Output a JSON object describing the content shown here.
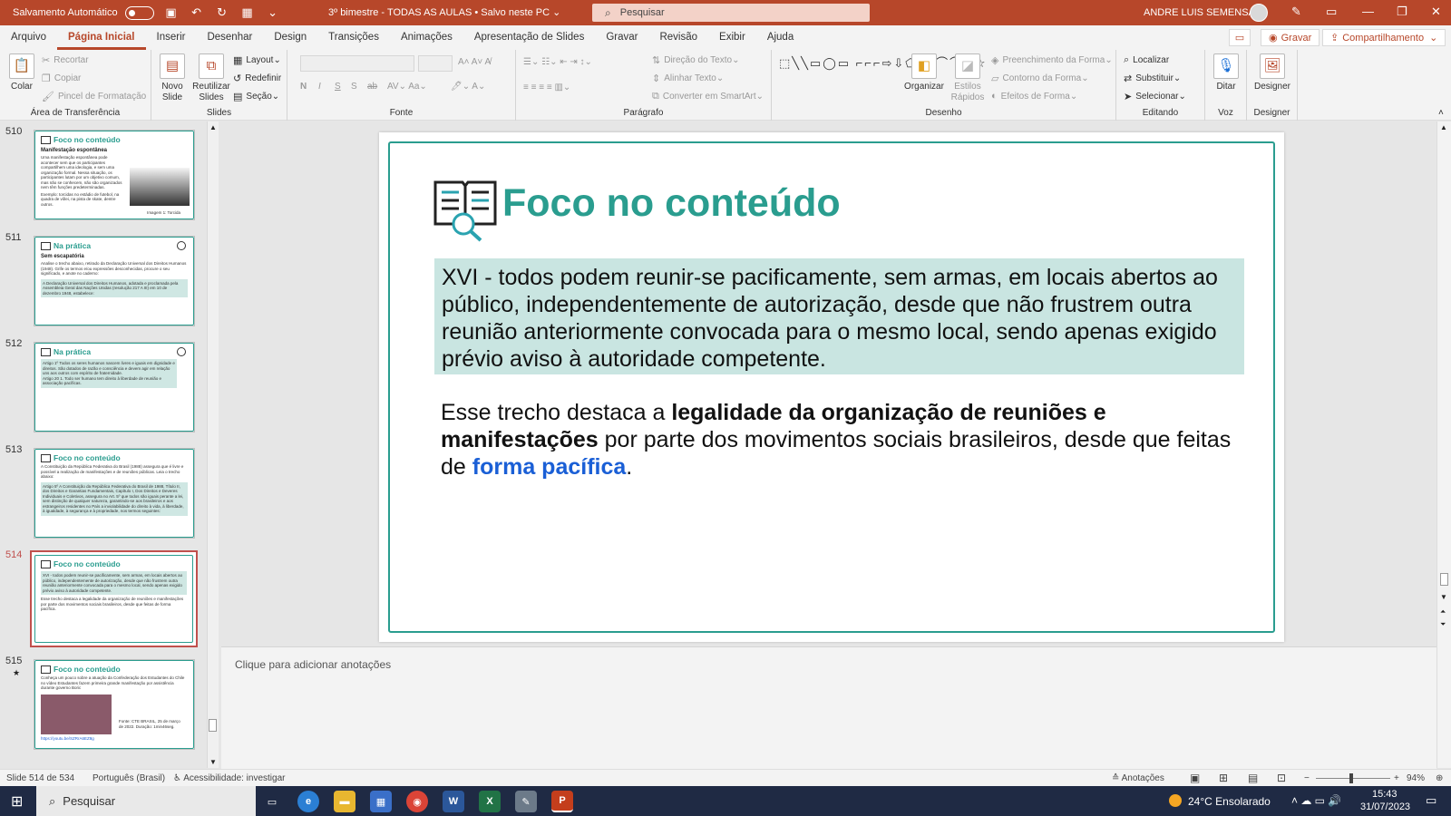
{
  "titlebar": {
    "autosave_label": "Salvamento Automático",
    "doc_title": "3º bimestre - TODAS AS AULAS • Salvo neste PC",
    "search_placeholder": "Pesquisar",
    "user": "ANDRE LUIS SEMENSATO"
  },
  "menu": {
    "tabs": [
      "Arquivo",
      "Página Inicial",
      "Inserir",
      "Desenhar",
      "Design",
      "Transições",
      "Animações",
      "Apresentação de Slides",
      "Gravar",
      "Revisão",
      "Exibir",
      "Ajuda"
    ],
    "record_label": "Gravar",
    "share_label": "Compartilhamento"
  },
  "ribbon": {
    "clipboard": {
      "paste": "Colar",
      "cut": "Recortar",
      "copy": "Copiar",
      "painter": "Pincel de Formatação",
      "label": "Área de Transferência"
    },
    "slides": {
      "new_slide_1": "Novo",
      "new_slide_2": "Slide",
      "reuse_1": "Reutilizar",
      "reuse_2": "Slides",
      "layout": "Layout",
      "reset": "Redefinir",
      "section": "Seção",
      "label": "Slides"
    },
    "font": {
      "bold": "N",
      "italic": "I",
      "underline": "S",
      "shadow": "S",
      "strike": "ab",
      "label": "Fonte"
    },
    "paragraph": {
      "text_dir": "Direção do Texto",
      "align_text": "Alinhar Texto",
      "smartart": "Converter em SmartArt",
      "label": "Parágrafo"
    },
    "drawing": {
      "arrange": "Organizar",
      "styles_1": "Estilos",
      "styles_2": "Rápidos",
      "fill": "Preenchimento da Forma",
      "outline": "Contorno da Forma",
      "effects": "Efeitos de Forma",
      "label": "Desenho"
    },
    "editing": {
      "find": "Localizar",
      "replace": "Substituir",
      "select": "Selecionar",
      "label": "Editando"
    },
    "voice": {
      "dictate": "Ditar",
      "label": "Voz"
    },
    "designer": {
      "designer": "Designer",
      "label": "Designer"
    }
  },
  "thumbnails": [
    {
      "num": "510",
      "title": "Foco no conteúdo",
      "subtitle": "Manifestação espontânea",
      "text": "Uma manifestação espontânea pode acontecer sem que os participantes compartilhem uma ideologia, e sem uma organização formal. Nessa situação, os participantes lutam por um objetivo comum, mas não se conhecem, não são organizados nem têm funções predeterminadas.",
      "text2": "Exemplo: torcidas no estádio de futebol, na quadra de vôlei, na pista de skate, dentre outros.",
      "caption": "Imagem 1: Torcida"
    },
    {
      "num": "511",
      "title": "Na prática",
      "subtitle": "Sem escapatória",
      "text": "Analise o trecho abaixo, retirado da Declaração Universal dos Direitos Humanos (1948). Grife os termos e/ou expressões desconhecidas, procure o seu significado, e anote no caderno:",
      "box": "A Declaração Universal dos Direitos Humanos, adotada e proclamada pela Assembleia Geral das Nações Unidas (resolução 217 A III) em 10 de dezembro 1948, estabelece:"
    },
    {
      "num": "512",
      "title": "Na prática",
      "box": "Artigo 1º Todos os seres humanos nascem livres e iguais em dignidade e direitos. São dotados de razão e consciência e devem agir em relação uns aos outros com espírito de fraternidade.",
      "box2": "Artigo 20 1. Todo ser humano tem direito à liberdade de reunião e associação pacíficas."
    },
    {
      "num": "513",
      "title": "Foco no conteúdo",
      "text": "A Constituição da República Federativa do Brasil (1988) assegura que é livre e possível a realização de manifestações e de reuniões públicas. Leia o trecho abaixo:",
      "box": "Artigo 5º A Constituição da República Federativa do Brasil de 1988, Título II, dos Direitos e Garantias Fundamentais, Capítulo I, Dos Direitos e Deveres Individuais e Coletivos, assegura no Art. 5º que todos são iguais perante a lei, sem distinção de qualquer natureza, garantindo-se aos brasileiros e aos estrangeiros residentes no País a inviolabilidade do direito à vida, à liberdade, à igualdade, à segurança e à propriedade, nos termos seguintes:"
    },
    {
      "num": "514",
      "title": "Foco no conteúdo",
      "box": "XVI - todos podem reunir-se pacificamente, sem armas, em locais abertos ao público, independentemente de autorização, desde que não frustrem outra reunião anteriormente convocada para o mesmo local, sendo apenas exigido prévio aviso à autoridade competente.",
      "text": "Esse trecho destaca a legalidade da organização de reuniões e manifestações por parte dos movimentos sociais brasileiros, desde que feitas de forma pacífica."
    },
    {
      "num": "515",
      "star": "★",
      "title": "Foco no conteúdo",
      "text": "Conheça um pouco sobre a atuação da Confederação dos Estudantes do Chile no vídeo Estudantes fazem primeira grande manifestação por assistência durante governo Boric",
      "caption": "Fonte: CTE BRASIL, 25 de março de 2022. Duração: 1min46seg.",
      "link": "https://youtu.be/SZRrA6EZ8g"
    }
  ],
  "slide": {
    "title": "Foco no conteúdo",
    "quote": "XVI - todos podem reunir-se pacificamente, sem armas, em locais abertos ao público, independentemente de autorização, desde que não frustrem outra reunião anteriormente convocada para o mesmo local, sendo apenas exigido prévio aviso à autoridade competente.",
    "para_start": "Esse trecho destaca a ",
    "para_bold": "legalidade da organização de reuniões e manifestações",
    "para_mid": " por parte dos movimentos sociais brasileiros, desde que feitas de ",
    "para_highlight": "forma pacífica",
    "para_end": "."
  },
  "notes_placeholder": "Clique para adicionar anotações",
  "status": {
    "slide_count": "Slide 514 de 534",
    "language": "Português (Brasil)",
    "accessibility": "Acessibilidade: investigar",
    "notes": "Anotações",
    "zoom": "94%"
  },
  "taskbar": {
    "search": "Pesquisar",
    "weather": "24°C  Ensolarado",
    "time": "15:43",
    "date": "31/07/2023"
  },
  "colors": {
    "accent": "#b7472a",
    "teal": "#2a9d8f",
    "highlight_blue": "#1a5fd6",
    "quote_bg": "#c9e5e1"
  }
}
